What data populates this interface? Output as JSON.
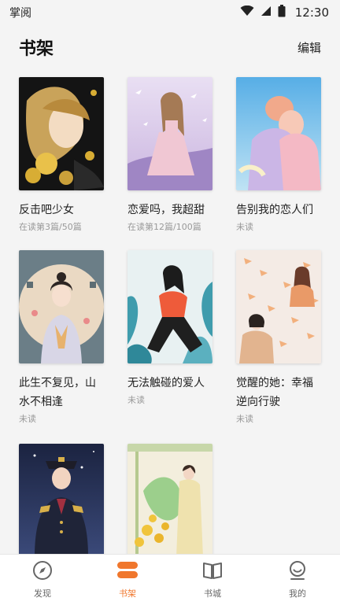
{
  "status": {
    "app": "掌阅",
    "time": "12:30"
  },
  "header": {
    "title": "书架",
    "edit": "编辑"
  },
  "books": [
    {
      "title": "反击吧少女",
      "progress": "在读第3篇/50篇"
    },
    {
      "title": "恋爱吗，我超甜",
      "progress": "在读第12篇/100篇"
    },
    {
      "title": "告别我的恋人们",
      "progress": "未读"
    },
    {
      "title": "此生不复见，山水不相逢",
      "progress": "未读"
    },
    {
      "title": "无法触碰的爱人",
      "progress": "未读"
    },
    {
      "title": "觉醒的她：幸福逆向行驶",
      "progress": "未读"
    },
    {
      "title": "",
      "progress": ""
    },
    {
      "title": "",
      "progress": ""
    }
  ],
  "nav": [
    {
      "label": "发现",
      "icon": "compass-icon"
    },
    {
      "label": "书架",
      "icon": "bookshelf-icon"
    },
    {
      "label": "书城",
      "icon": "book-icon"
    },
    {
      "label": "我的",
      "icon": "profile-icon"
    }
  ],
  "colors": {
    "accent": "#f0772d",
    "inactive": "#666666",
    "background": "#f4f4f4"
  }
}
